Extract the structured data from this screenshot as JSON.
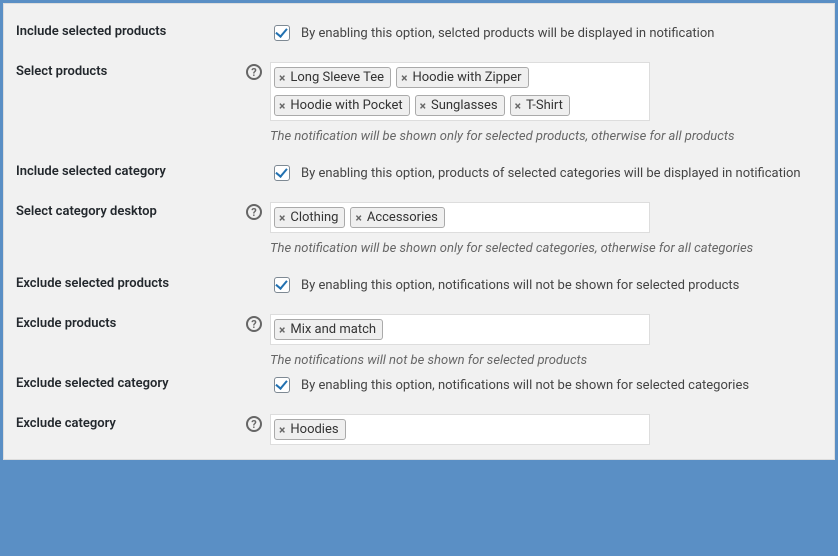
{
  "rows": {
    "includeProducts": {
      "label": "Include selected products",
      "desc": "By enabling this option, selcted products will be displayed in notification"
    },
    "selectProducts": {
      "label": "Select products",
      "tags": [
        "Long Sleeve Tee",
        "Hoodie with Zipper",
        "Hoodie with Pocket",
        "Sunglasses",
        "T-Shirt"
      ],
      "hint": "The notification will be shown only for selected products, otherwise for all products"
    },
    "includeCategory": {
      "label": "Include selected category",
      "desc": "By enabling this option, products of selected categories will be displayed in notification"
    },
    "selectCategoryDesktop": {
      "label": "Select category desktop",
      "tags": [
        "Clothing",
        "Accessories"
      ],
      "hint": "The notification will be shown only for selected categories, otherwise for all categories"
    },
    "excludeProducts": {
      "label": "Exclude selected products",
      "desc": "By enabling this option, notifications will not be shown for selected products"
    },
    "excludeProductsField": {
      "label": "Exclude products",
      "tags": [
        "Mix and match"
      ],
      "hint": "The notifications will not be shown for selected products"
    },
    "excludeCategory": {
      "label": "Exclude selected category",
      "desc": "By enabling this option, notifications will not be shown for selected categories"
    },
    "excludeCategoryField": {
      "label": "Exclude category",
      "tags": [
        "Hoodies"
      ]
    }
  }
}
